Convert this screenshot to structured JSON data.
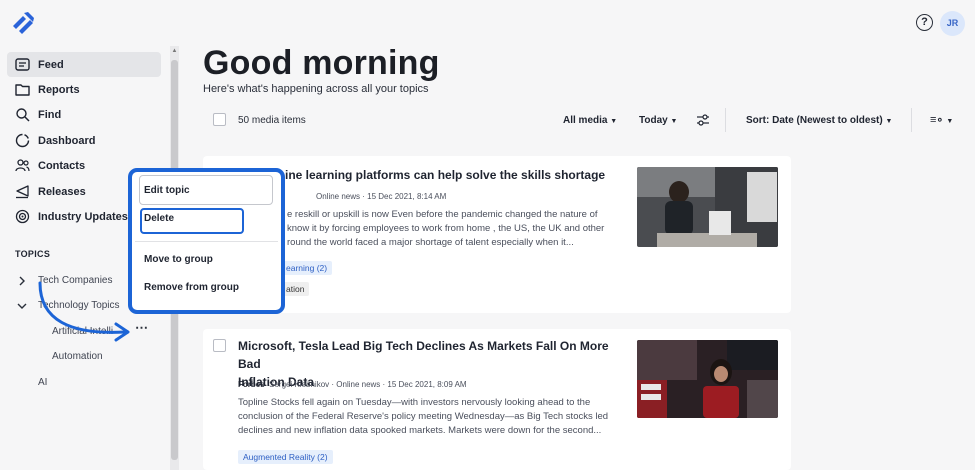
{
  "header": {
    "help_icon": "question-circle-icon",
    "avatar_initials": "JR"
  },
  "sidebar": {
    "nav": [
      {
        "label": "Feed",
        "icon": "feed-icon"
      },
      {
        "label": "Reports",
        "icon": "folder-icon"
      },
      {
        "label": "Find",
        "icon": "search-icon"
      },
      {
        "label": "Dashboard",
        "icon": "dashboard-icon"
      },
      {
        "label": "Contacts",
        "icon": "contacts-icon"
      },
      {
        "label": "Releases",
        "icon": "megaphone-icon"
      },
      {
        "label": "Industry Updates",
        "icon": "broadcast-icon"
      }
    ],
    "topics_heading": "TOPICS",
    "topics": [
      {
        "label": "Tech Companies"
      },
      {
        "label": "Technology Topics"
      },
      {
        "label": "Artificial Intelli"
      },
      {
        "label": "Automation"
      },
      {
        "label": "AI"
      }
    ]
  },
  "main": {
    "greeting": "Good morning",
    "subtitle": "Here's what's happening across all your topics",
    "toolbar": {
      "count": "50 media items",
      "media_filter": "All media",
      "date_filter": "Today",
      "sort": "Sort: Date (Newest to oldest)"
    },
    "articles": [
      {
        "title_visible": "ine learning platforms can help solve the skills shortage",
        "meta_visible": "Online news · 15 Dec 2021, 8:14 AM",
        "excerpt_lines": [
          "e reskill or upskill is now Even before the pandemic changed the nature of",
          "know it by forcing employees to work from home , the US, the UK and other",
          "round the world faced a major shortage of talent especially when it..."
        ],
        "tag1": "earning (2)",
        "tag2": "ation"
      },
      {
        "title_line1": "Microsoft, Tesla Lead Big Tech Declines As Markets Fall On More Bad",
        "title_line2": "Inflation Data",
        "source": "Forbes",
        "author_meta": "Sergei Klebnikov · Online news · 15 Dec 2021, 8:09 AM",
        "excerpt_lines": [
          "Topline Stocks fell again on Tuesday—with investors nervously looking ahead to the",
          "conclusion of the Federal Reserve's policy meeting Wednesday—as Big Tech stocks led",
          "declines and new inflation data spooked markets. Markets were down for the second..."
        ],
        "tag1": "Augmented Reality (2)"
      }
    ]
  },
  "context_menu": {
    "edit": "Edit topic",
    "delete": "Delete",
    "move": "Move to group",
    "remove": "Remove from group"
  },
  "colors": {
    "accent": "#1c64d6",
    "tag_bg": "#e6effc",
    "tag_text": "#2d5fc4"
  }
}
